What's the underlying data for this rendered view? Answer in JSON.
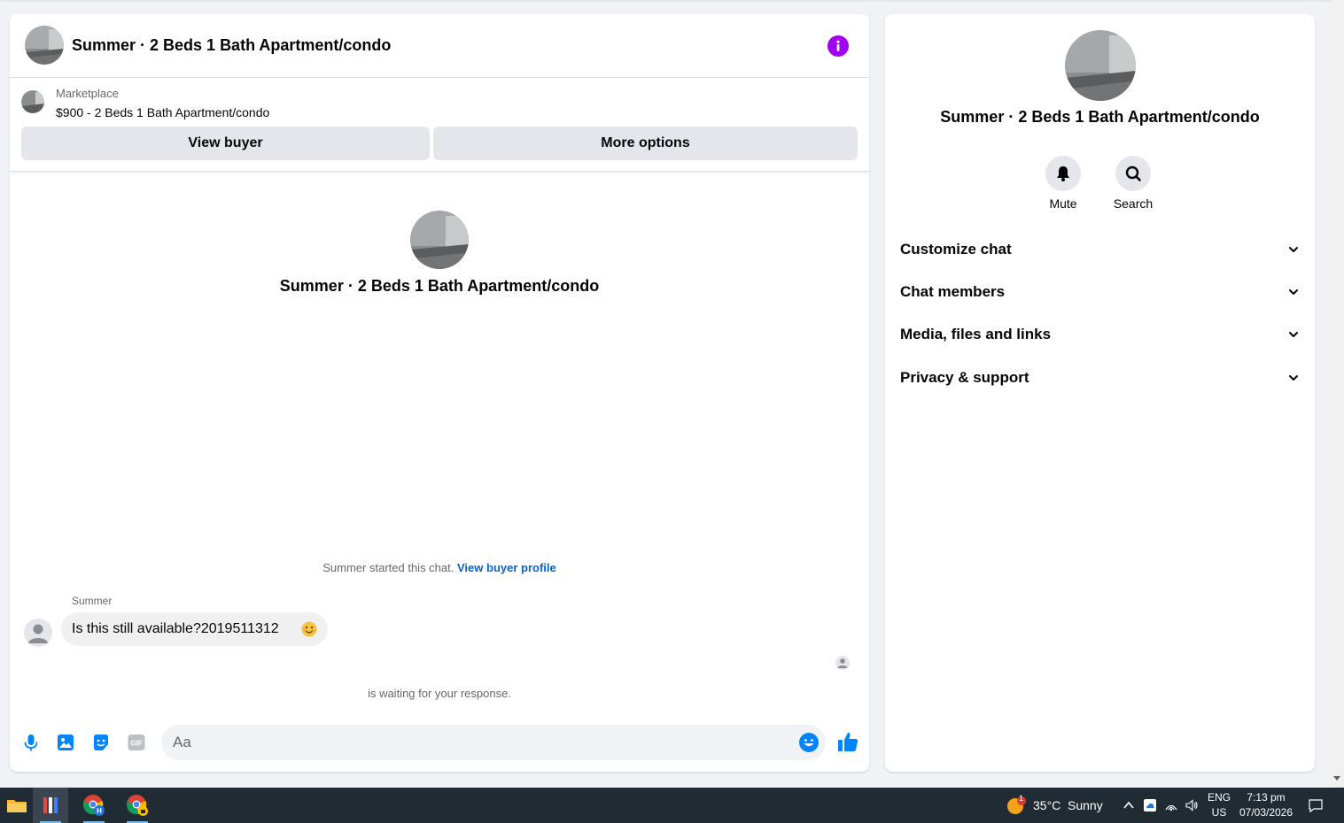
{
  "colors": {
    "accent": "#a100f2",
    "messenger_blue": "#0084ff",
    "link_blue": "#0064d1",
    "taskbar": "#202b33"
  },
  "header": {
    "title": "Summer · 2 Beds 1 Bath Apartment/condo",
    "info_icon": "info-icon"
  },
  "marketplace": {
    "label": "Marketplace",
    "listing": "$900 - 2 Beds 1 Bath Apartment/condo",
    "view_buyer_label": "View buyer",
    "more_options_label": "More options"
  },
  "conversation": {
    "title": "Summer · 2 Beds 1 Bath Apartment/condo",
    "started_text": "Summer started this chat.",
    "view_profile_link": "View buyer profile",
    "messages": [
      {
        "sender": "Summer",
        "text": "Is this still available?2019511312"
      }
    ],
    "waiting_text": "is waiting for your response."
  },
  "composer": {
    "placeholder": "Aa",
    "icons": [
      "microphone-icon",
      "photo-icon",
      "sticker-icon",
      "gif-icon",
      "emoji-icon",
      "thumbs-up-icon"
    ]
  },
  "sidebar": {
    "title": "Summer · 2 Beds 1 Bath Apartment/condo",
    "actions": [
      {
        "label": "Mute",
        "icon": "bell-icon"
      },
      {
        "label": "Search",
        "icon": "search-icon"
      }
    ],
    "sections": [
      {
        "label": "Customize chat"
      },
      {
        "label": "Chat members"
      },
      {
        "label": "Media, files and links"
      },
      {
        "label": "Privacy & support"
      }
    ]
  },
  "taskbar": {
    "weather": {
      "temp": "35°C",
      "condition": "Sunny",
      "badge": "1"
    },
    "language": {
      "lang": "ENG",
      "region": "US"
    },
    "clock": {
      "time": "7:13 pm",
      "date": "07/03/2026"
    }
  }
}
